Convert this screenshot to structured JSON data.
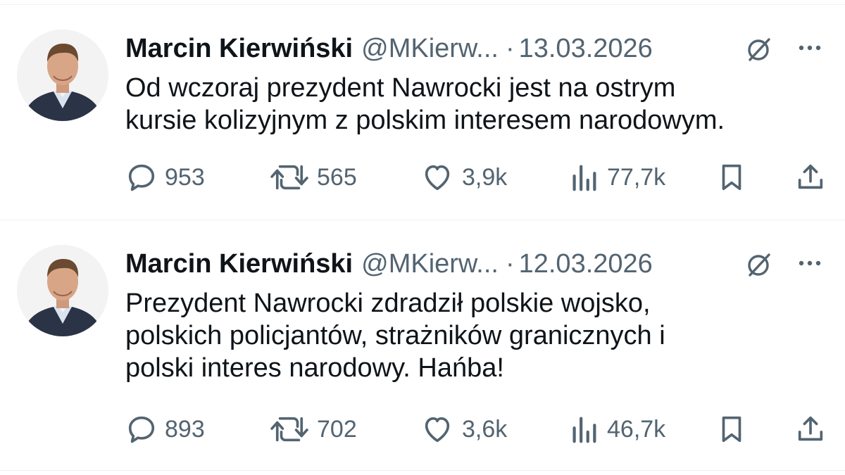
{
  "colors": {
    "text": "#0f1419",
    "muted": "#536471",
    "divider": "#eff3f4",
    "background": "#ffffff"
  },
  "tweets": [
    {
      "author_name": "Marcin Kierwiński",
      "handle": "@MKierw...",
      "separator": "·",
      "date": "13.03.2026",
      "text_lines": [
        "Od wczoraj prezydent Nawrocki jest na ostrym",
        "kursie kolizyjnym z polskim interesem narodowym."
      ],
      "replies": "953",
      "reposts": "565",
      "likes": "3,9k",
      "views": "77,7k",
      "icons": [
        "avatar-photo",
        "grok-icon",
        "more-icon",
        "reply-icon",
        "repost-icon",
        "like-icon",
        "views-icon",
        "bookmark-icon",
        "share-icon"
      ]
    },
    {
      "author_name": "Marcin Kierwiński",
      "handle": "@MKierw...",
      "separator": "·",
      "date": "12.03.2026",
      "text_lines": [
        "Prezydent Nawrocki zdradził polskie wojsko,",
        "polskich policjantów, strażników granicznych i",
        "polski interes narodowy. Hańba!"
      ],
      "replies": "893",
      "reposts": "702",
      "likes": "3,6k",
      "views": "46,7k",
      "icons": [
        "avatar-photo",
        "grok-icon",
        "more-icon",
        "reply-icon",
        "repost-icon",
        "like-icon",
        "views-icon",
        "bookmark-icon",
        "share-icon"
      ]
    }
  ]
}
